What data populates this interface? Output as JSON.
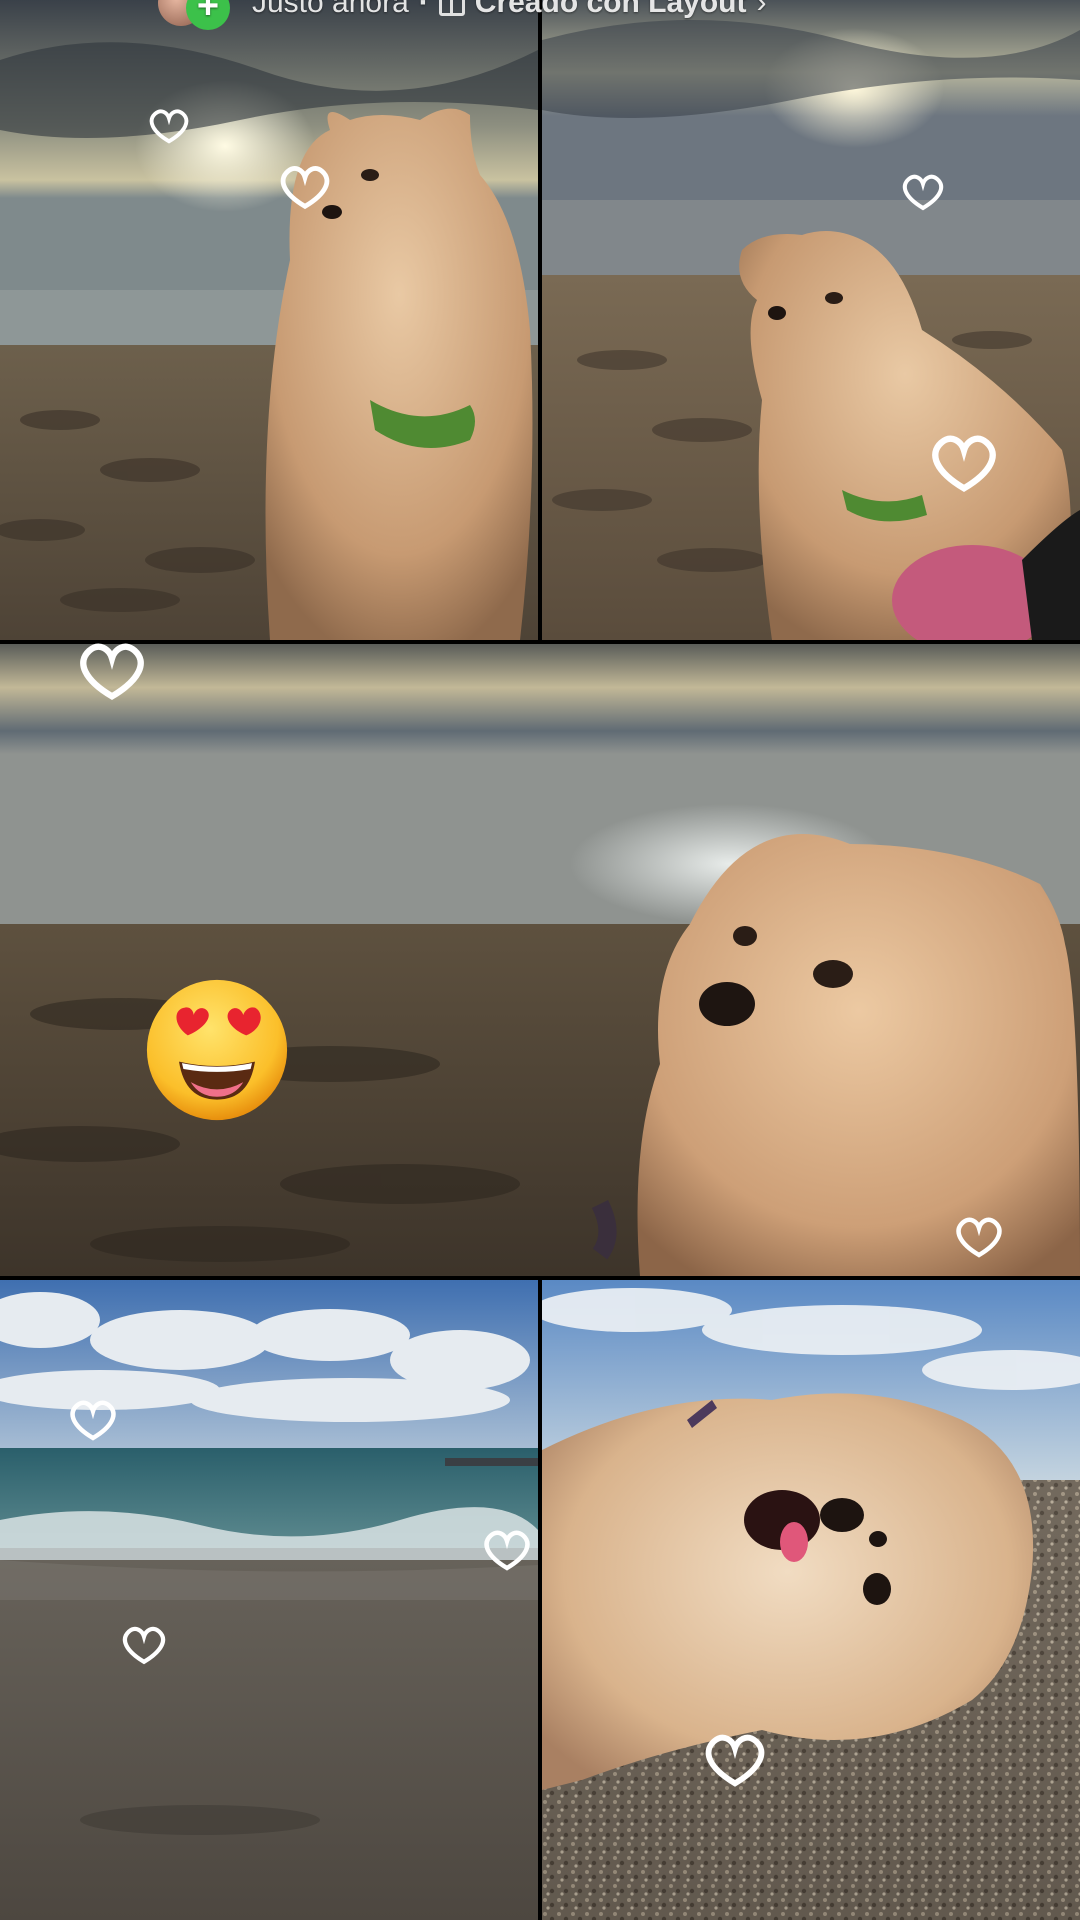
{
  "header": {
    "time_label": "Justo ahora",
    "separator": "·",
    "layout_label": "Creado con Layout",
    "chevron": "›"
  },
  "panels": [
    {
      "name": "dog-on-beach-sitting",
      "position": "top-left"
    },
    {
      "name": "dog-on-beach-side-view",
      "position": "top-right"
    },
    {
      "name": "dog-closeup-beach",
      "position": "middle"
    },
    {
      "name": "sea-waves-beach",
      "position": "bottom-left"
    },
    {
      "name": "dog-lying-on-sand",
      "position": "bottom-right"
    }
  ],
  "stickers": {
    "emoji": "heart-eyes-emoji",
    "hearts": "white-outline-heart-doodle"
  },
  "colors": {
    "sand": "#6b5a44",
    "dog_fur": "#d9b48a",
    "sky_blue": "#4a78b8",
    "sea": "#2e6b78",
    "badge_green": "#3cc14a"
  }
}
